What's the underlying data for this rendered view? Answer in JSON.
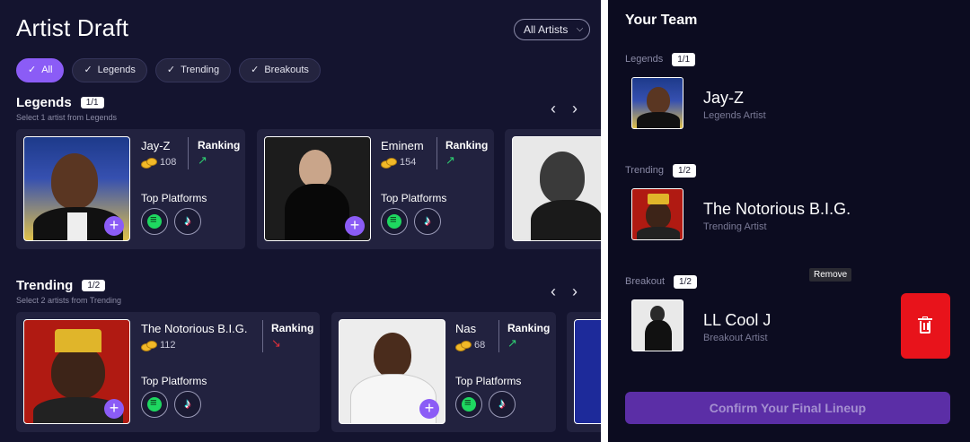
{
  "page": {
    "title": "Artist Draft",
    "filter_label": "All Artists"
  },
  "chips": [
    {
      "label": "All",
      "active": true
    },
    {
      "label": "Legends",
      "active": false
    },
    {
      "label": "Trending",
      "active": false
    },
    {
      "label": "Breakouts",
      "active": false
    }
  ],
  "sections": {
    "legends": {
      "title": "Legends",
      "badge": "1/1",
      "subtitle": "Select 1 artist from Legends",
      "cards": [
        {
          "name": "Jay-Z",
          "coins": "108",
          "ranking_label": "Ranking",
          "trend": "up",
          "platforms_label": "Top Platforms"
        },
        {
          "name": "Eminem",
          "coins": "154",
          "ranking_label": "Ranking",
          "trend": "up",
          "platforms_label": "Top Platforms"
        }
      ]
    },
    "trending": {
      "title": "Trending",
      "badge": "1/2",
      "subtitle": "Select 2 artists from Trending",
      "cards": [
        {
          "name": "The Notorious B.I.G.",
          "coins": "112",
          "ranking_label": "Ranking",
          "trend": "down",
          "platforms_label": "Top Platforms"
        },
        {
          "name": "Nas",
          "coins": "68",
          "ranking_label": "Ranking",
          "trend": "up",
          "platforms_label": "Top Platforms"
        }
      ]
    }
  },
  "team": {
    "title": "Your Team",
    "slots": [
      {
        "label": "Legends",
        "badge": "1/1",
        "name": "Jay-Z",
        "subtitle": "Legends Artist"
      },
      {
        "label": "Trending",
        "badge": "1/2",
        "name": "The Notorious B.I.G.",
        "subtitle": "Trending Artist"
      },
      {
        "label": "Breakout",
        "badge": "1/2",
        "name": "LL Cool J",
        "subtitle": "Breakout Artist"
      }
    ],
    "remove_tooltip": "Remove",
    "confirm_label": "Confirm Your Final Lineup"
  },
  "icons": {
    "check": "check-icon",
    "chevron": "chevron-down-icon",
    "coin": "coins-icon",
    "trend_up": "trend-up-icon",
    "trend_down": "trend-down-icon",
    "spotify": "spotify-icon",
    "tiktok": "tiktok-icon",
    "add": "plus-icon",
    "trash": "trash-icon"
  },
  "colors": {
    "accent": "#8b5cf6",
    "trend_up": "#2ecc71",
    "trend_down": "#e0303a",
    "delete": "#e8131b",
    "confirm": "#5b2ea6"
  }
}
